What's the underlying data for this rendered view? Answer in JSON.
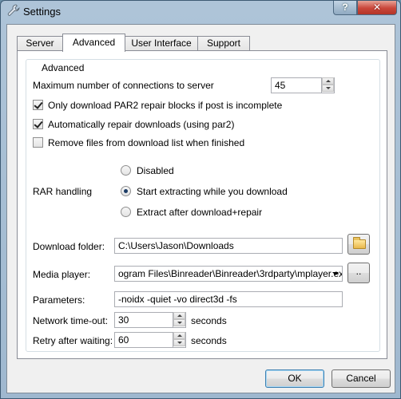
{
  "window": {
    "title": "Settings",
    "help_label": "?",
    "close_label": "✕"
  },
  "tabs": [
    {
      "label": "Server"
    },
    {
      "label": "Advanced"
    },
    {
      "label": "User Interface"
    },
    {
      "label": "Support"
    }
  ],
  "advanced": {
    "group_title": "Advanced",
    "max_connections": {
      "label": "Maximum number of connections to server",
      "value": "45"
    },
    "checks": [
      {
        "label": "Only download PAR2 repair blocks if post is incomplete",
        "checked": true
      },
      {
        "label": "Automatically repair downloads (using par2)",
        "checked": true
      },
      {
        "label": "Remove files from download list when finished",
        "checked": false
      }
    ],
    "rar": {
      "label": "RAR handling",
      "options": [
        {
          "label": "Disabled",
          "selected": false
        },
        {
          "label": "Start extracting while you download",
          "selected": true
        },
        {
          "label": "Extract after download+repair",
          "selected": false
        }
      ]
    },
    "download_folder": {
      "label": "Download folder:",
      "value": "C:\\Users\\Jason\\Downloads",
      "browse": "folder-icon"
    },
    "media_player": {
      "label": "Media player:",
      "value": "ogram Files\\Binreader\\Binreader\\3rdparty\\mplayer.exe",
      "browse_label": ".."
    },
    "parameters": {
      "label": "Parameters:",
      "value": "-noidx -quiet -vo direct3d -fs"
    },
    "network_timeout": {
      "label": "Network time-out:",
      "value": "30",
      "unit": "seconds"
    },
    "retry_after": {
      "label": "Retry after waiting:",
      "value": "60",
      "unit": "seconds"
    }
  },
  "buttons": {
    "ok": "OK",
    "cancel": "Cancel"
  }
}
